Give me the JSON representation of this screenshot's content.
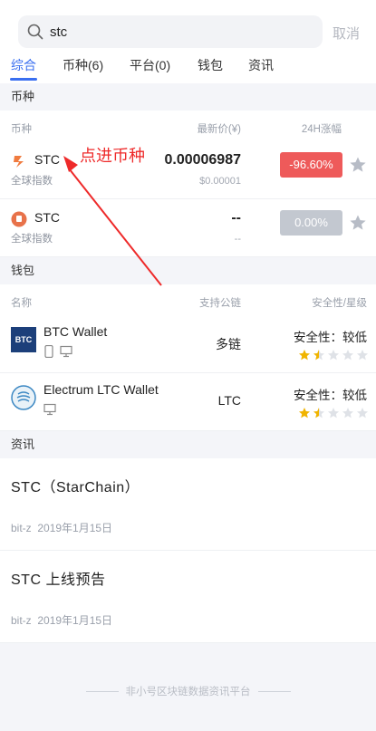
{
  "search": {
    "query": "stc",
    "cancel_label": "取消"
  },
  "tabs": [
    {
      "label": "综合"
    },
    {
      "label": "币种(6)"
    },
    {
      "label": "平台(0)"
    },
    {
      "label": "钱包"
    },
    {
      "label": "资讯"
    }
  ],
  "coins_section": {
    "title": "币种",
    "col_coin": "币种",
    "col_price": "最新价(¥)",
    "col_change": "24H涨幅",
    "rows": [
      {
        "name": "STC",
        "sub": "全球指数",
        "price": "0.00006987",
        "usd": "$0.00001",
        "change": "-96.60%",
        "logo_color": "#f07b3f"
      },
      {
        "name": "STC",
        "sub": "全球指数",
        "price": "--",
        "usd": "--",
        "change": "0.00%",
        "logo_color": "#e8724a"
      }
    ]
  },
  "wallet_section": {
    "title": "钱包",
    "col_name": "名称",
    "col_chain": "支持公链",
    "col_safety": "安全性/星级",
    "rows": [
      {
        "name": "BTC Wallet",
        "chain": "多链",
        "safety": "安全性：较低",
        "rating": 1.5
      },
      {
        "name": "Electrum LTC Wallet",
        "chain": "LTC",
        "safety": "安全性：较低",
        "rating": 1.5
      }
    ]
  },
  "news_section": {
    "title": "资讯",
    "items": [
      {
        "title": "STC（StarChain）",
        "source": "bit-z",
        "date": "2019年1月15日"
      },
      {
        "title": "STC 上线预告",
        "source": "bit-z",
        "date": "2019年1月15日"
      }
    ]
  },
  "footer": "非小号区块链数据资讯平台",
  "annotation": "点进币种",
  "colors": {
    "accent": "#3a6ff0",
    "down": "#ee5a5a",
    "neutral": "#c3c8d0",
    "annotation": "#ee2a2a",
    "star": "#f0b400"
  }
}
